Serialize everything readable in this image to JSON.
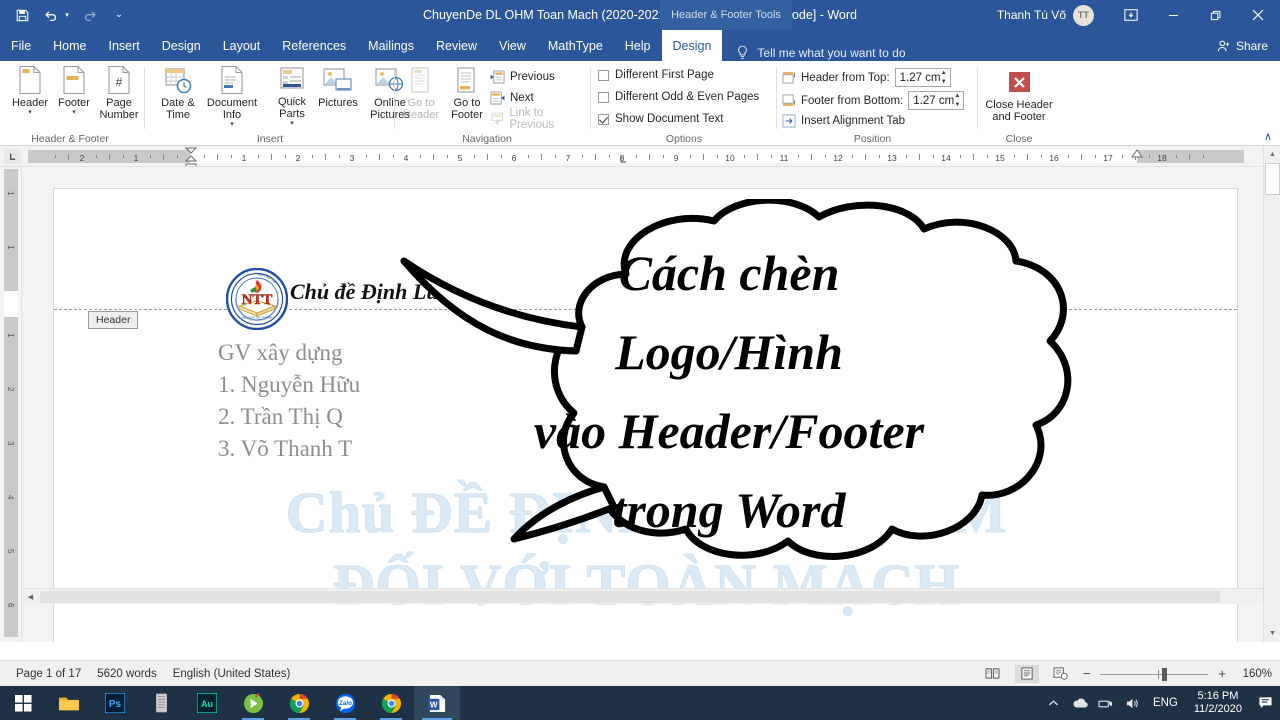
{
  "titlebar": {
    "quick_access": [
      {
        "name": "save",
        "glyph": "Ὃe"
      },
      {
        "name": "undo",
        "glyph": "↶"
      },
      {
        "name": "redo",
        "glyph": "↷"
      },
      {
        "name": "customize",
        "glyph": "≡"
      }
    ],
    "document_title": "ChuyenDe DL OHM Toan Mach (2020-2021).docx [Compatibility Mode]  -  Word",
    "contextual_tools": "Header & Footer Tools",
    "user_name": "Thanh Tú Võ",
    "user_initials": "TT",
    "ribbon_display_label": "Ribbon Display Options",
    "minimize_label": "—",
    "restore_label": "❐",
    "close_label": "✕"
  },
  "tabs": [
    {
      "label": "File",
      "active": false
    },
    {
      "label": "Home",
      "active": false
    },
    {
      "label": "Insert",
      "active": false
    },
    {
      "label": "Design",
      "active": false
    },
    {
      "label": "Layout",
      "active": false
    },
    {
      "label": "References",
      "active": false
    },
    {
      "label": "Mailings",
      "active": false
    },
    {
      "label": "Review",
      "active": false
    },
    {
      "label": "View",
      "active": false
    },
    {
      "label": "MathType",
      "active": false
    },
    {
      "label": "Help",
      "active": false
    },
    {
      "label": "Design",
      "active": true
    }
  ],
  "tell_me": "Tell me what you want to do",
  "share_label": "Share",
  "ribbon": {
    "collapse_label": "∧",
    "groups": [
      {
        "name": "header-footer",
        "label": "Header & Footer",
        "buttons": [
          {
            "label": "Header",
            "caret": true
          },
          {
            "label": "Footer",
            "caret": true
          },
          {
            "label": "Page\nNumber",
            "caret": true
          }
        ]
      },
      {
        "name": "insert",
        "label": "Insert",
        "buttons": [
          {
            "label": "Date &\nTime",
            "caret": false
          },
          {
            "label": "Document\nInfo",
            "caret": true
          },
          {
            "label": "Quick\nParts",
            "caret": true
          },
          {
            "label": "Pictures",
            "caret": false
          },
          {
            "label": "Online\nPictures",
            "caret": false
          }
        ]
      },
      {
        "name": "navigation",
        "label": "Navigation",
        "buttons": [
          {
            "label": "Go to\nHeader",
            "disabled": true
          },
          {
            "label": "Go to\nFooter",
            "disabled": false
          }
        ],
        "small_items": [
          {
            "label": "Previous",
            "disabled": false
          },
          {
            "label": "Next",
            "disabled": false
          },
          {
            "label": "Link to Previous",
            "disabled": true
          }
        ]
      },
      {
        "name": "options",
        "label": "Options",
        "checkboxes": [
          {
            "label": "Different First Page",
            "checked": false
          },
          {
            "label": "Different Odd & Even Pages",
            "checked": false
          },
          {
            "label": "Show Document Text",
            "checked": true
          }
        ]
      },
      {
        "name": "position",
        "label": "Position",
        "fields": [
          {
            "label": "Header from Top:",
            "value": "1.27 cm"
          },
          {
            "label": "Footer from Bottom:",
            "value": "1.27 cm"
          }
        ],
        "alignment_tab_label": "Insert Alignment Tab"
      },
      {
        "name": "close",
        "label": "Close",
        "buttons": [
          {
            "label": "Close Header\nand Footer"
          }
        ]
      }
    ]
  },
  "ruler": {
    "horizontal_ticks": [
      "2",
      "1",
      "1",
      "2",
      "3",
      "4",
      "5",
      "6",
      "7",
      "8",
      "9",
      "10",
      "11",
      "12",
      "13",
      "14",
      "15",
      "16",
      "17",
      "18"
    ],
    "tab_stop_label": "L"
  },
  "document": {
    "header_tag_label": "Header",
    "logo_text": "NTT",
    "logo_ring_top": "TRƯỜNG THPT NGUYỄN TẤT THÀNH",
    "header_text": "Chủ đề Định Luật",
    "body_lines": [
      "GV xây dựng",
      "1. Nguyễn Hữu",
      "2. Trần Thị Q",
      "3. Võ Thanh T"
    ],
    "watermark_line1": "Chủ ĐỀ ĐỊNH LUẬT OHM",
    "watermark_line2": "ĐỐI VỚI TOÀN MẠCH",
    "bubble_text": "Cách chèn\nLogo/Hình\nvào Header/Footer\ntrong Word"
  },
  "status_bar": {
    "page": "Page 1 of 17",
    "words": "5620 words",
    "language": "English (United States)",
    "views": [
      "read-mode-icon",
      "print-layout-icon",
      "web-layout-icon"
    ],
    "zoom_out": "−",
    "zoom_in": "+",
    "zoom_level": "160%"
  },
  "taskbar": {
    "items": [
      {
        "name": "start-button",
        "label": "Start"
      },
      {
        "name": "file-explorer",
        "label": "File Explorer"
      },
      {
        "name": "photoshop",
        "label": "Ps"
      },
      {
        "name": "unikey",
        "label": "UniKey"
      },
      {
        "name": "audition",
        "label": "Au"
      },
      {
        "name": "camtasia",
        "label": "Camtasia"
      },
      {
        "name": "chrome",
        "label": "Chrome"
      },
      {
        "name": "zalo",
        "label": "Zalo"
      },
      {
        "name": "chrome-2",
        "label": "Chrome"
      },
      {
        "name": "word",
        "label": "W"
      }
    ],
    "tray": {
      "language": "ENG",
      "time": "5:16 PM",
      "date": "11/2/2020"
    }
  },
  "colors": {
    "word_blue": "#2b579a",
    "ribbon_bg": "#ffffff",
    "watermark": "#dbeaf5",
    "taskbar": "#1f3245"
  }
}
